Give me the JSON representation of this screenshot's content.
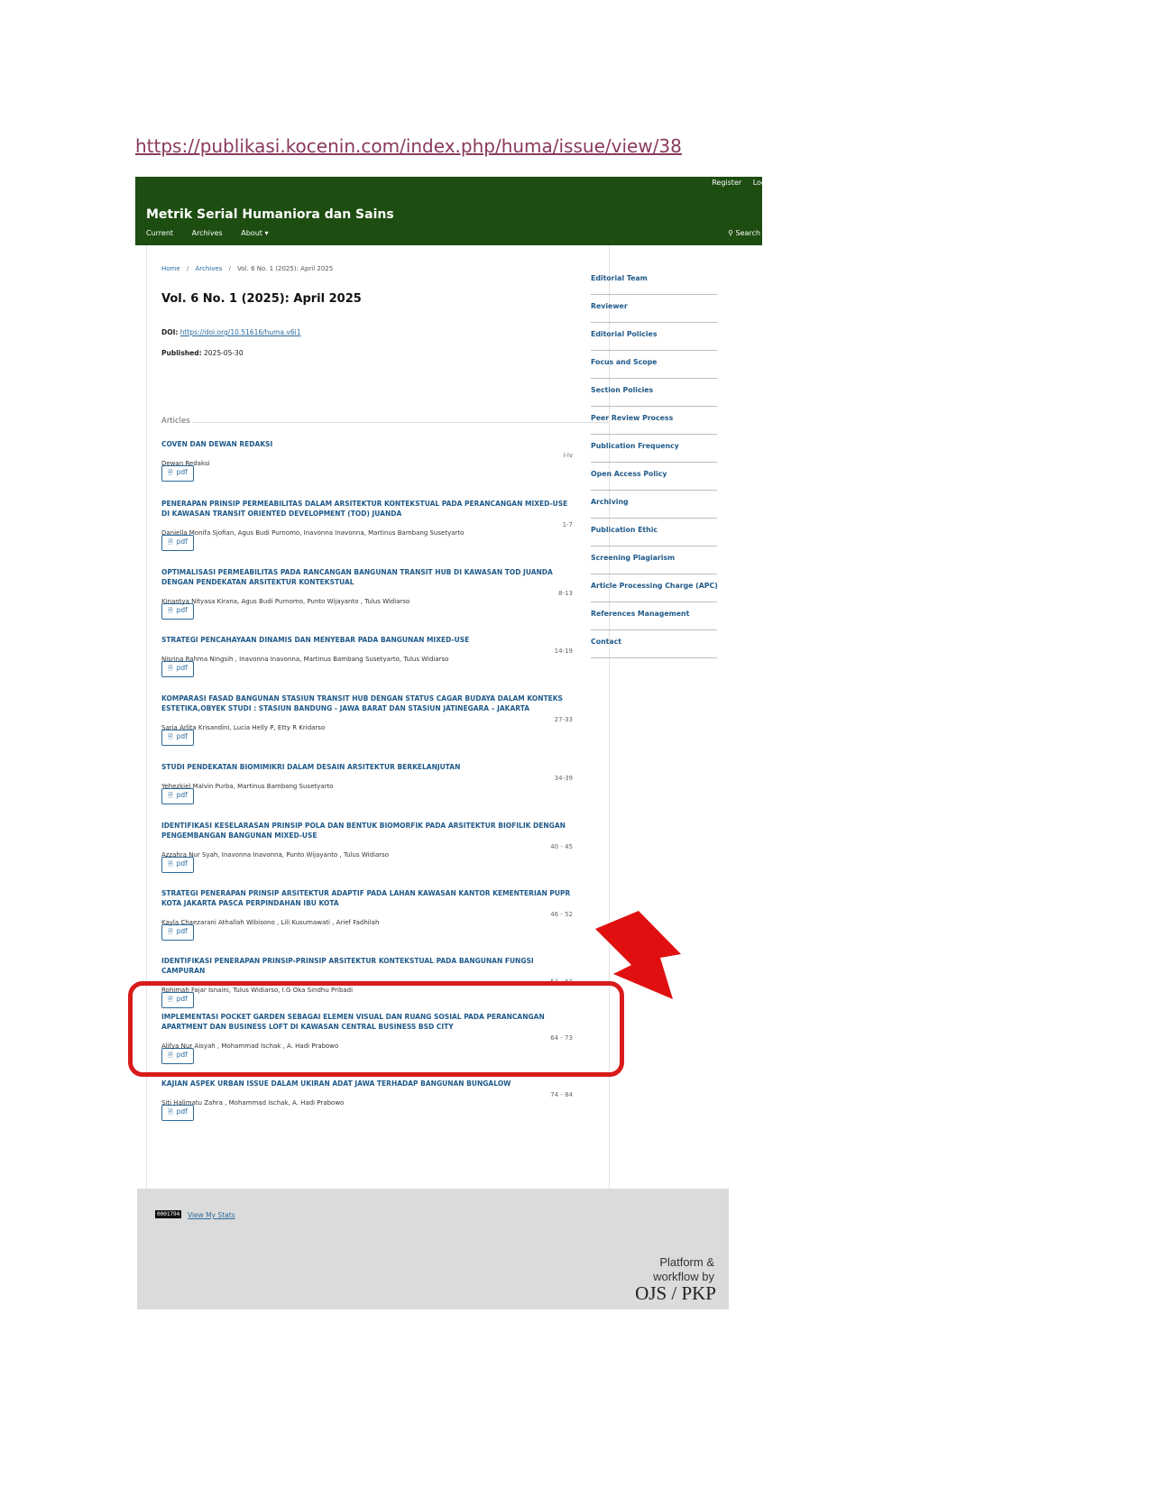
{
  "doc_link": "https://publikasi.kocenin.com/index.php/huma/issue/view/38",
  "header": {
    "register": "Register",
    "login": "Log",
    "site_title": "Metrik Serial Humaniora dan Sains",
    "nav": {
      "current": "Current",
      "archives": "Archives",
      "about": "About ▾"
    },
    "search": "Search"
  },
  "breadcrumb": {
    "home": "Home",
    "archives": "Archives",
    "current": "Vol. 6 No. 1 (2025): April 2025"
  },
  "issue": {
    "title": "Vol. 6 No. 1 (2025): April 2025",
    "doi_label": "DOI:",
    "doi_value": "https://doi.org/10.51616/huma.v6i1",
    "published_label": "Published:",
    "published_value": "2025-05-30"
  },
  "section": "Articles",
  "pdf_label": "pdf",
  "articles": [
    {
      "title": "COVEN DAN DEWAN REDAKSI",
      "authors": "Dewan Redaksi",
      "pages": "i-iv"
    },
    {
      "title": "PENERAPAN PRINSIP PERMEABILITAS DALAM ARSITEKTUR KONTEKSTUAL PADA PERANCANGAN MIXED-USE DI KAWASAN TRANSIT ORIENTED DEVELOPMENT (TOD) JUANDA",
      "authors": "Daniella Monifa Sjofian, Agus Budi Purnomo, Inavonna Inavonna, Martinus Bambang Susetyarto",
      "pages": "1-7"
    },
    {
      "title": "OPTIMALISASI PERMEABILITAS PADA RANCANGAN BANGUNAN TRANSIT HUB DI KAWASAN TOD JUANDA DENGAN PENDEKATAN ARSITEKTUR KONTEKSTUAL",
      "authors": "Kinantya Nityasa Kirana, Agus Budi Purnomo, Punto Wijayanto , Tulus Widiarso",
      "pages": "8-13"
    },
    {
      "title": "STRATEGI PENCAHAYAAN DINAMIS DAN MENYEBAR PADA BANGUNAN MIXED-USE",
      "authors": "Nisrina Rahma Ningsih , Inavonna Inavonna, Martinus Bambang Susetyarto, Tulus Widiarso",
      "pages": "14-19"
    },
    {
      "title": "KOMPARASI FASAD BANGUNAN STASIUN TRANSIT HUB DENGAN STATUS CAGAR BUDAYA DALAM KONTEKS ESTETIKA,OBYEK STUDI : STASIUN BANDUNG - JAWA BARAT DAN STASIUN JATINEGARA – JAKARTA",
      "authors": "Saria Arlita Krisandini, Lucia Helly P, Etty R Kridarso",
      "pages": "27-33"
    },
    {
      "title": "STUDI PENDEKATAN BIOMIMIKRI DALAM DESAIN ARSITEKTUR BERKELANJUTAN",
      "authors": "Yehezkiel Malvin Purba, Martinus Bambang Susetyarto",
      "pages": "34-39"
    },
    {
      "title": "IDENTIFIKASI KESELARASAN PRINSIP POLA DAN BENTUK BIOMORFIK PADA ARSITEKTUR BIOFILIK DENGAN PENGEMBANGAN BANGUNAN MIXED-USE",
      "authors": "Azzahra Nur Syah, Inavonna Inavonna, Punto Wijayanto , Tulus Widiarso",
      "pages": "40 - 45"
    },
    {
      "title": "STRATEGI PENERAPAN PRINSIP ARSITEKTUR ADAPTIF PADA LAHAN KAWASAN KANTOR KEMENTERIAN PUPR KOTA JAKARTA PASCA PERPINDAHAN IBU KOTA",
      "authors": "Kayla Chaezarani Athallah Wibisono , Lili Kusumawati , Arief Fadhilah",
      "pages": "46 - 52"
    },
    {
      "title": "IDENTIFIKASI PENERAPAN PRINSIP-PRINSIP ARSITEKTUR KONTEKSTUAL PADA BANGUNAN FUNGSI CAMPURAN",
      "authors": "Rohimah Fajar Isnaini, Tulus Widiarso, I.G Oka Sindhu Pribadi",
      "pages": "53 - 63"
    },
    {
      "title": "IMPLEMENTASI POCKET GARDEN SEBAGAI ELEMEN VISUAL DAN RUANG SOSIAL PADA PERANCANGAN APARTMENT DAN BUSINESS LOFT DI KAWASAN CENTRAL BUSINESS BSD CITY",
      "authors": "Alifya Nur Aisyah , Mohammad Ischak , A. Hadi Prabowo",
      "pages": "64 - 73"
    },
    {
      "title": "KAJIAN ASPEK URBAN ISSUE DALAM UKIRAN ADAT JAWA TERHADAP BANGUNAN BUNGALOW",
      "authors": "Siti Halimatu Zahra , Mohammad Ischak, A. Hadi Prabowo",
      "pages": "74 - 84"
    }
  ],
  "sidebar": [
    "Editorial Team",
    "Reviewer",
    "Editorial Policies",
    "Focus and Scope",
    "Section Policies",
    "Peer Review Process",
    "Publication Frequency",
    "Open Access Policy",
    "Archiving",
    "Publication Ethic",
    "Screening Plagiarism",
    "Article Processing Charge (APC)",
    "References Management",
    "Contact"
  ],
  "footer": {
    "counter": "0001794",
    "stats_link": "View My Stats",
    "platform_line1": "Platform &",
    "platform_line2": "workflow by",
    "logo_text": "OJS / PKP"
  },
  "annotation": {
    "highlighted_article_index": 9,
    "color": "#d81b1b"
  },
  "colors": {
    "header_bg": "#1d4d11",
    "link": "#2a6b9e",
    "title_link": "#1f5a8a",
    "footer_bg": "#dbdbdb"
  }
}
